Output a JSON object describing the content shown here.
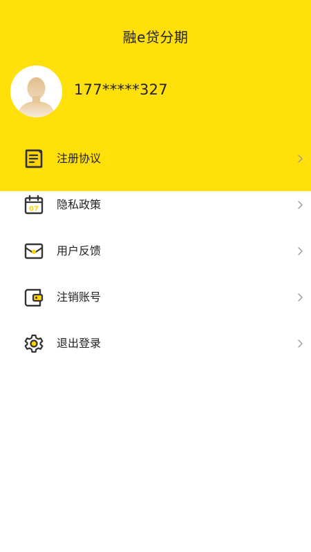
{
  "header": {
    "title": "融e贷分期"
  },
  "profile": {
    "avatar_icon": "user-avatar-icon",
    "phone": "177*****327"
  },
  "menu": {
    "items": [
      {
        "label": "注册协议",
        "icon": "document-icon"
      },
      {
        "label": "隐私政策",
        "icon": "calendar-icon"
      },
      {
        "label": "用户反馈",
        "icon": "envelope-icon"
      },
      {
        "label": "注销账号",
        "icon": "wallet-icon"
      },
      {
        "label": "退出登录",
        "icon": "gear-icon"
      }
    ]
  },
  "calendar_icon_text": "07",
  "colors": {
    "header_bg": "#FFE00A",
    "icon_dark": "#333333",
    "icon_accent": "#FFD400",
    "chevron": "#999999"
  }
}
